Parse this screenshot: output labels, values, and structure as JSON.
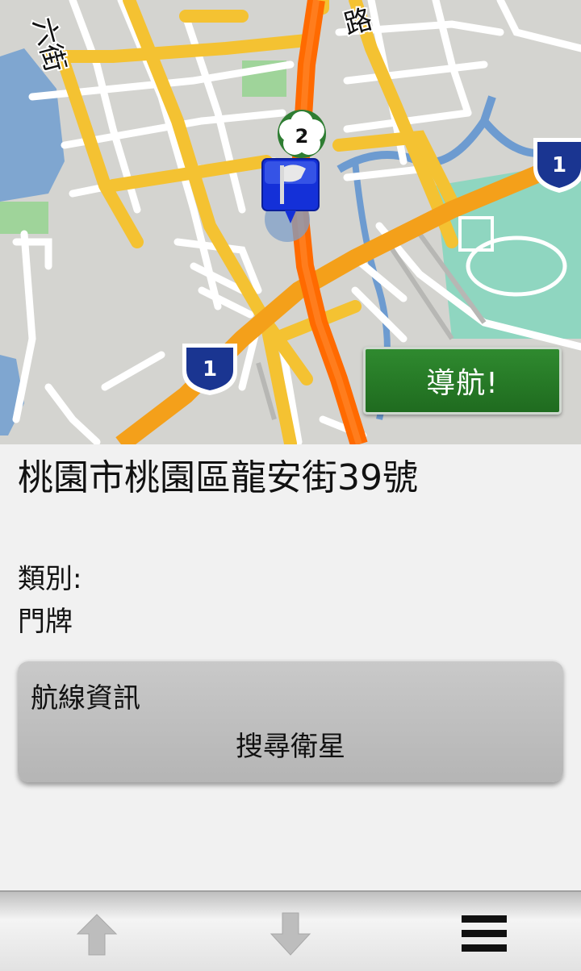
{
  "map": {
    "street_labels": [
      "六街",
      "路"
    ],
    "route_shields": [
      "2",
      "1",
      "1"
    ],
    "navigate_label": "導航!"
  },
  "place": {
    "address": "桃園市桃園區龍安街39號",
    "category_label": "類別:",
    "category_value": "門牌"
  },
  "route_card": {
    "title": "航線資訊",
    "status": "搜尋衛星"
  },
  "toolbar": {
    "icons": [
      "arrow-up-icon",
      "arrow-down-icon",
      "menu-icon"
    ]
  },
  "colors": {
    "accent_green": "#2a7d2a",
    "route_orange": "#ff6a00",
    "major_road": "#f4c232",
    "water": "#7fa6d0"
  }
}
